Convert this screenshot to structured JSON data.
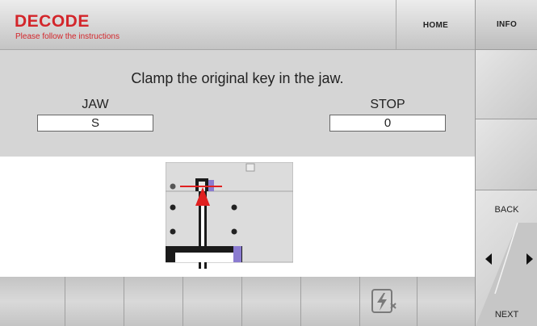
{
  "header": {
    "title": "DECODE",
    "subtitle": "Please follow the instructions",
    "home_label": "HOME"
  },
  "sidebar": {
    "info_label": "INFO",
    "back_label": "BACK",
    "next_label": "NEXT"
  },
  "instruction": {
    "text": "Clamp the original key in the jaw.",
    "jaw_label": "JAW",
    "jaw_value": "S",
    "stop_label": "STOP",
    "stop_value": "0"
  },
  "toolbar": {
    "icons": [
      "cutter-disabled-icon"
    ]
  },
  "colors": {
    "brand_red": "#d3262b",
    "panel_gray": "#d5d5d5"
  }
}
